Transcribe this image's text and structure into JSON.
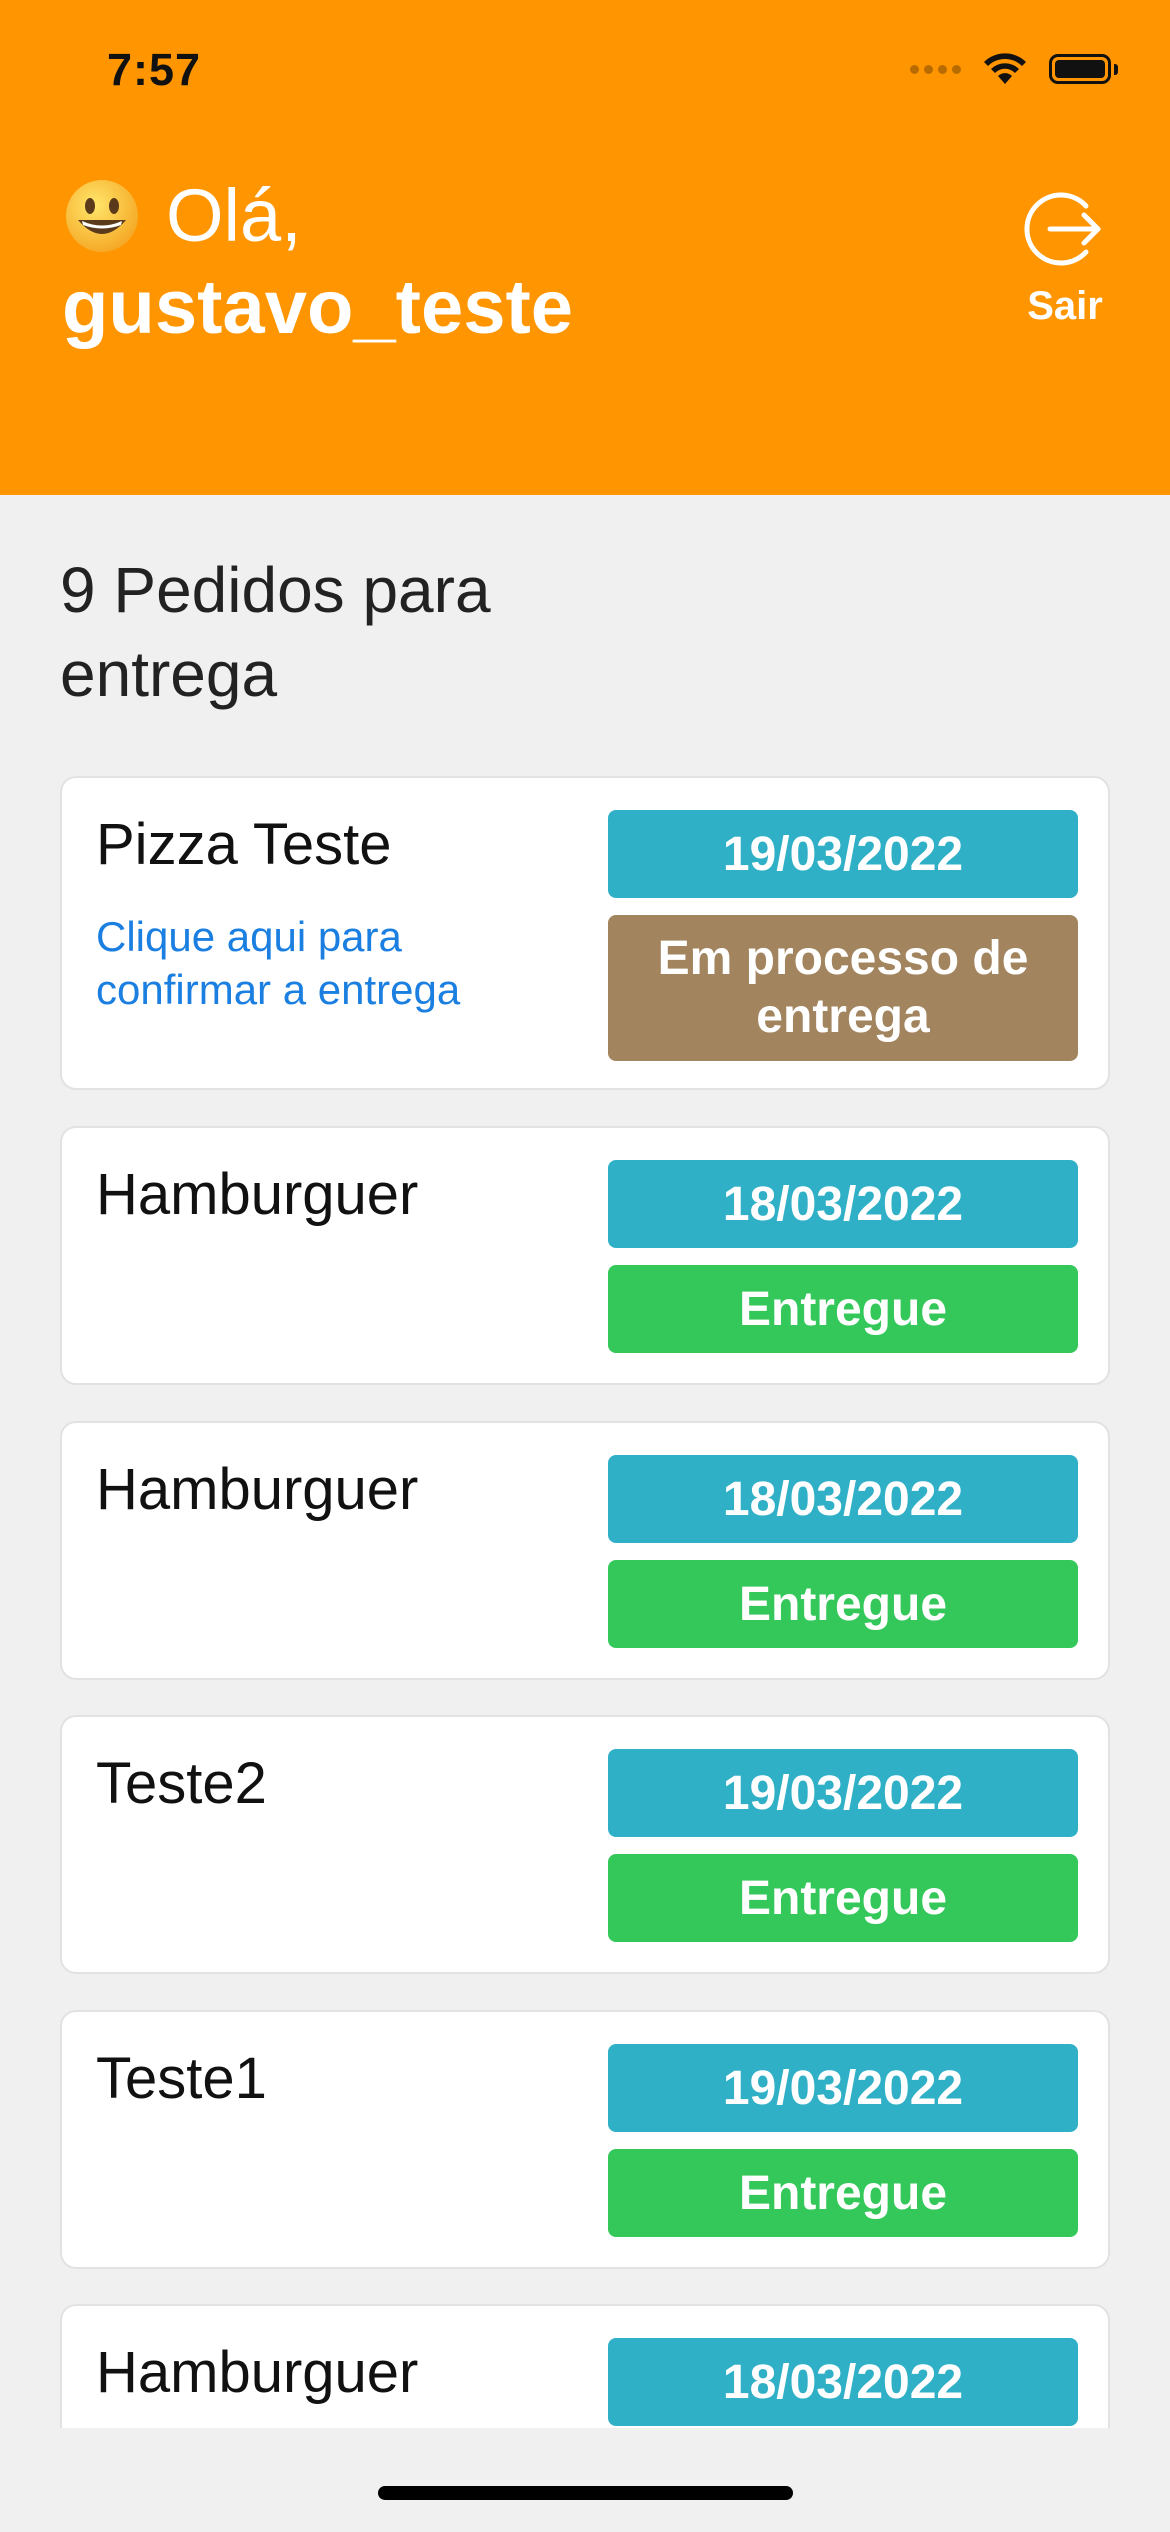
{
  "status_bar": {
    "time": "7:57"
  },
  "header": {
    "greeting": "Olá,",
    "username": "gustavo_teste",
    "emoji_icon": "grinning-face-emoji",
    "logout_label": "Sair",
    "background_color": "#ff9500"
  },
  "orders": {
    "title": "9 Pedidos para entrega",
    "items": [
      {
        "name": "Pizza Teste",
        "date": "19/03/2022",
        "status": "Em processo de entrega",
        "status_color": "#a2845e",
        "action_link": "Clique aqui para confirmar a entrega"
      },
      {
        "name": "Hamburguer",
        "date": "18/03/2022",
        "status": "Entregue",
        "status_color": "#34c759"
      },
      {
        "name": "Hamburguer",
        "date": "18/03/2022",
        "status": "Entregue",
        "status_color": "#34c759"
      },
      {
        "name": "Teste2",
        "date": "19/03/2022",
        "status": "Entregue",
        "status_color": "#34c759"
      },
      {
        "name": "Teste1",
        "date": "19/03/2022",
        "status": "Entregue",
        "status_color": "#34c759"
      },
      {
        "name": "Hamburguer",
        "date": "18/03/2022"
      }
    ]
  },
  "colors": {
    "date_badge": "#30b0c7",
    "delivered_badge": "#34c759",
    "processing_badge": "#a2845e",
    "link": "#1a7fe0"
  }
}
